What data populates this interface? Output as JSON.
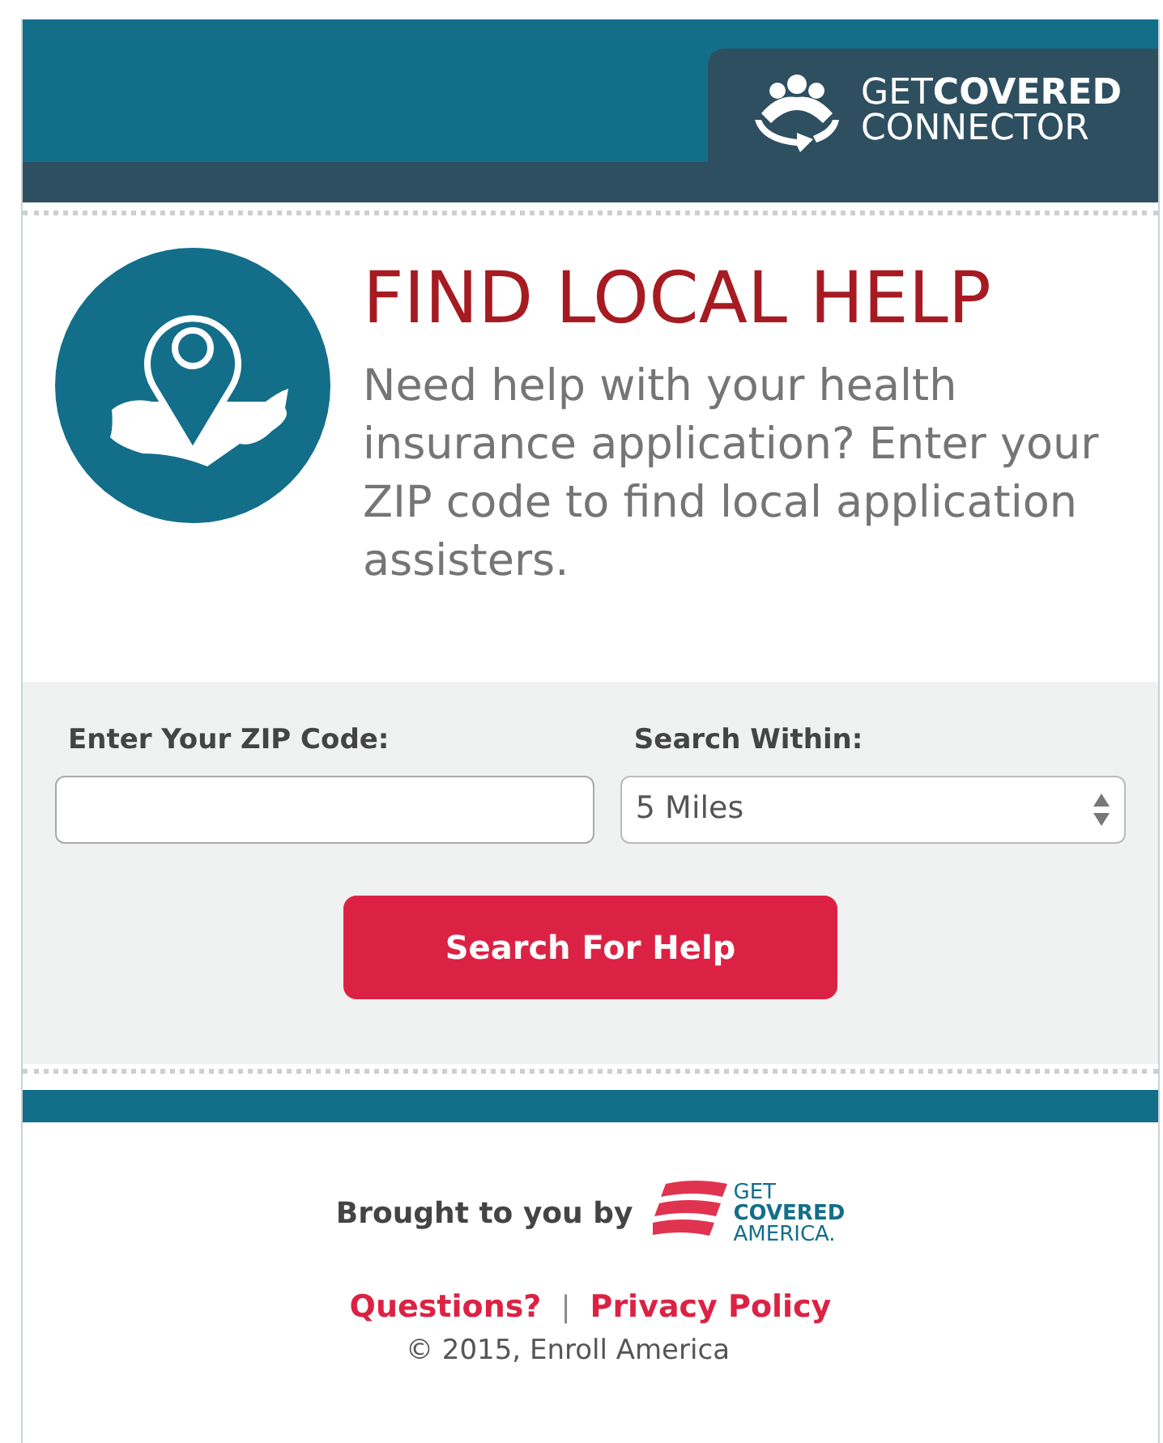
{
  "header": {
    "logo_lines": [
      "GET**COVERED**",
      "CONNECTOR"
    ]
  },
  "intro": {
    "title": "FIND LOCAL HELP",
    "text": "Need help with your health insurance application? Enter your ZIP code to find local application assisters."
  },
  "form": {
    "zip_label": "Enter Your ZIP Code:",
    "radius_label": "Search Within:",
    "radius_value": "5 Miles",
    "button": "Search For Help"
  },
  "footer": {
    "brought_by": "Brought to you by",
    "sponsor_logo_lines": [
      "GET",
      "**COVERED**",
      "AMERICA."
    ],
    "links": [
      "Questions?",
      "Privacy Policy"
    ],
    "separator": "|",
    "copyright": "© 2015, Enroll America"
  }
}
